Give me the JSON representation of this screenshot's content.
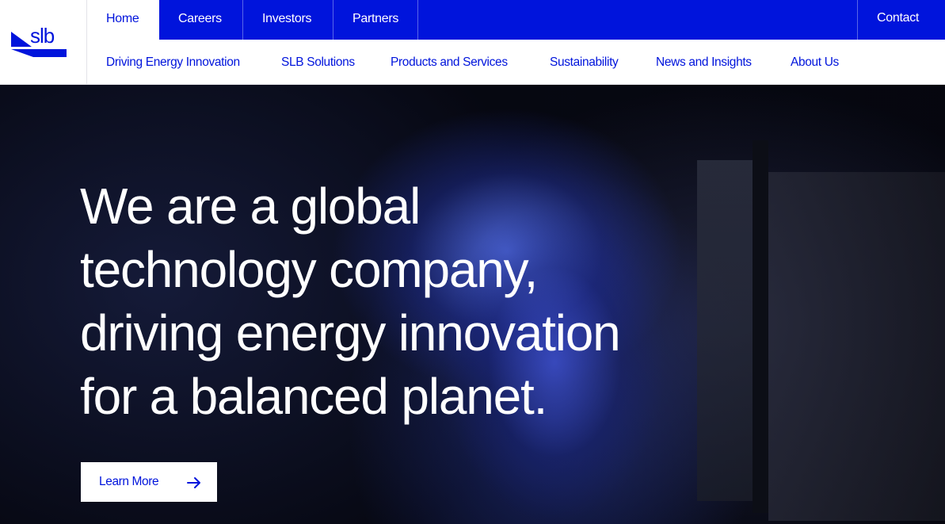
{
  "brand": {
    "logo_text": "slb",
    "accent": "#0014dc"
  },
  "top_nav": {
    "tabs": [
      {
        "label": "Home",
        "active": true
      },
      {
        "label": "Careers",
        "active": false
      },
      {
        "label": "Investors",
        "active": false
      },
      {
        "label": "Partners",
        "active": false
      }
    ],
    "contact_label": "Contact"
  },
  "main_nav": {
    "items": [
      {
        "label": "Driving Energy Innovation"
      },
      {
        "label": "SLB Solutions"
      },
      {
        "label": "Products and Services"
      },
      {
        "label": "Sustainability"
      },
      {
        "label": "News and Insights"
      },
      {
        "label": "About Us"
      }
    ]
  },
  "hero": {
    "headline_lines": [
      "We are a global",
      "technology company,",
      "driving energy innovation",
      "for a balanced planet."
    ],
    "cta_label": "Learn More",
    "cta_icon": "arrow-right-icon"
  }
}
